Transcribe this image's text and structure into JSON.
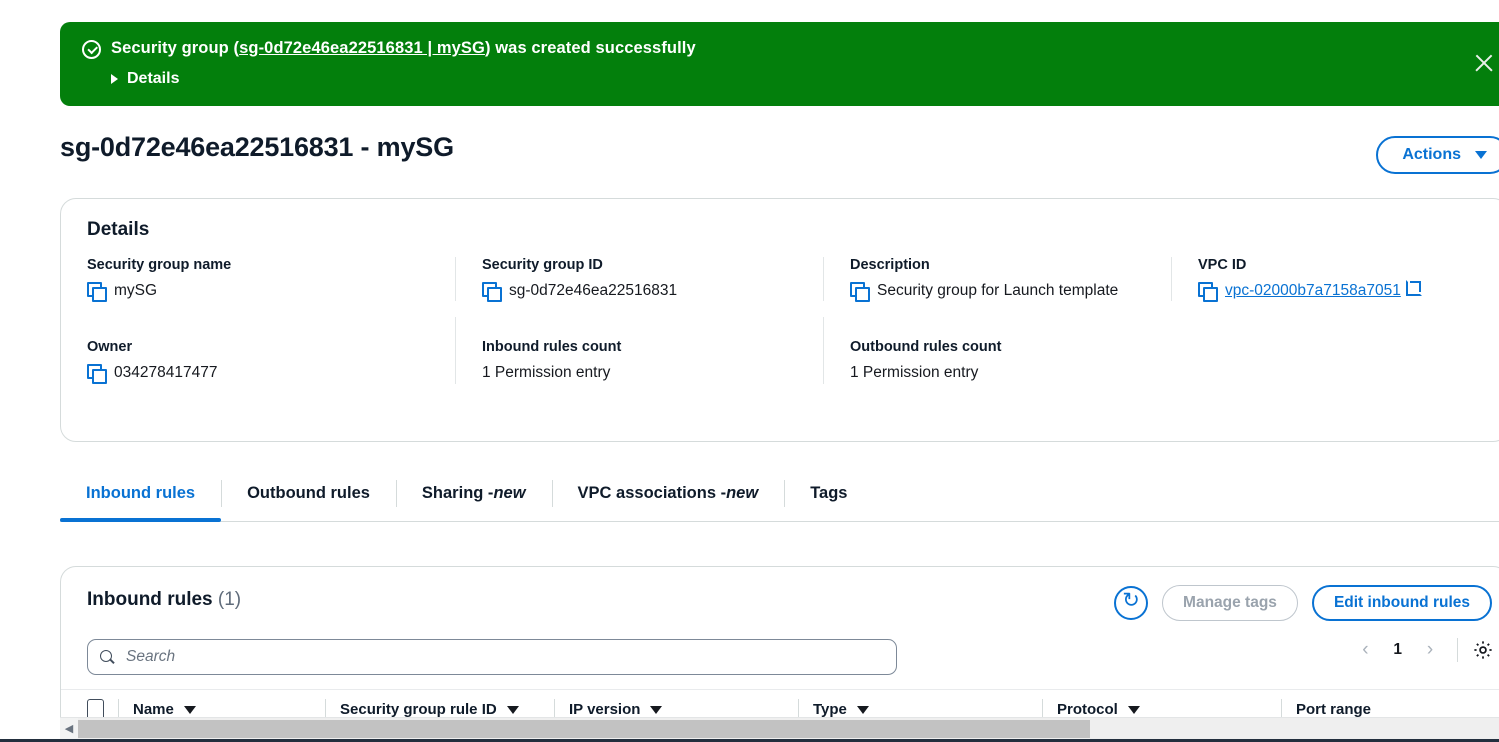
{
  "colors": {
    "success_green": "#037f0c",
    "link_blue": "#0972d3",
    "text_dark": "#0f1b2a",
    "muted": "#5f6b7a",
    "border": "#d5dbdb"
  },
  "flash": {
    "icon": "success-check-icon",
    "message_prefix": "Security group (",
    "resource_link": "sg-0d72e46ea22516831 | mySG",
    "message_suffix": ") was created successfully",
    "details_label": "Details",
    "close_label": "close-icon"
  },
  "header": {
    "title": "sg-0d72e46ea22516831 - mySG",
    "actions_label": "Actions"
  },
  "details": {
    "heading": "Details",
    "fields": [
      {
        "label": "Security group name",
        "value": "mySG",
        "copyable": true
      },
      {
        "label": "Security group ID",
        "value": "sg-0d72e46ea22516831",
        "copyable": true
      },
      {
        "label": "Description",
        "value": "Security group for Launch template",
        "copyable": true
      },
      {
        "label": "VPC ID",
        "value": "vpc-02000b7a7158a7051",
        "copyable": true,
        "link": true
      },
      {
        "label": "Owner",
        "value": "034278417477",
        "copyable": true
      },
      {
        "label": "Inbound rules count",
        "value": "1 Permission entry",
        "copyable": false
      },
      {
        "label": "Outbound rules count",
        "value": "1 Permission entry",
        "copyable": false
      }
    ]
  },
  "tabs": [
    {
      "label": "Inbound rules",
      "new": "",
      "active": true
    },
    {
      "label": "Outbound rules",
      "new": "",
      "active": false
    },
    {
      "label": "Sharing - ",
      "new": "new",
      "active": false
    },
    {
      "label": "VPC associations - ",
      "new": "new",
      "active": false
    },
    {
      "label": "Tags",
      "new": "",
      "active": false
    }
  ],
  "rules_panel": {
    "title": "Inbound rules",
    "count": "(1)",
    "refresh_label": "refresh-icon",
    "manage_tags_label": "Manage tags",
    "edit_rules_label": "Edit inbound rules",
    "search_placeholder": "Search",
    "search_value": "",
    "pagination": {
      "prev": "‹",
      "page": "1",
      "next": "›"
    },
    "settings_label": "settings-gear-icon",
    "columns": [
      "Name",
      "Security group rule ID",
      "IP version",
      "Type",
      "Protocol",
      "Port range"
    ],
    "rows": []
  }
}
